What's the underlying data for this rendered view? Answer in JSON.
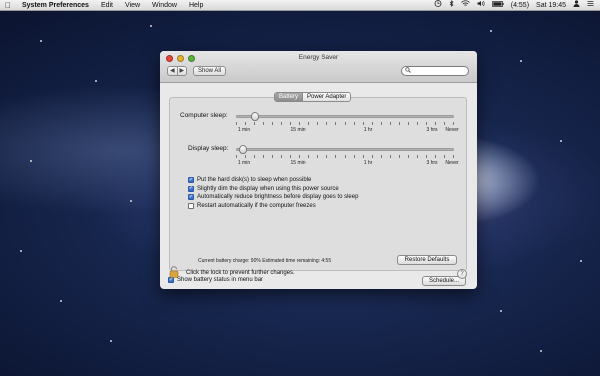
{
  "menubar": {
    "apple": "",
    "app_name": "System Preferences",
    "menus": [
      "Edit",
      "View",
      "Window",
      "Help"
    ],
    "battery_time": "(4:55)",
    "clock": "Sat 19:45"
  },
  "window": {
    "title": "Energy Saver",
    "show_all": "Show All",
    "search_placeholder": ""
  },
  "tabs": [
    {
      "label": "Battery",
      "active": true
    },
    {
      "label": "Power Adapter",
      "active": false
    }
  ],
  "computer_sleep": {
    "label": "Computer sleep:",
    "value_minutes": 5,
    "ticks": [
      "1 min",
      "15 min",
      "1 hr",
      "3 hrs",
      "Never"
    ]
  },
  "display_sleep": {
    "label": "Display sleep:",
    "value_minutes": 2,
    "ticks": [
      "1 min",
      "15 min",
      "1 hr",
      "3 hrs",
      "Never"
    ]
  },
  "options": [
    {
      "label": "Put the hard disk(s) to sleep when possible",
      "checked": true
    },
    {
      "label": "Slightly dim the display when using this power source",
      "checked": true
    },
    {
      "label": "Automatically reduce brightness before display goes to sleep",
      "checked": true
    },
    {
      "label": "Restart automatically if the computer freezes",
      "checked": false
    }
  ],
  "status": {
    "charge_text": "Current battery charge: 90%  Estimated time remaining: 4:55"
  },
  "buttons": {
    "restore": "Restore Defaults",
    "schedule": "Schedule..."
  },
  "show_battery": {
    "label": "Show battery status in menu bar",
    "checked": true
  },
  "lock_text": "Click the lock to prevent further changes.",
  "help": "?"
}
